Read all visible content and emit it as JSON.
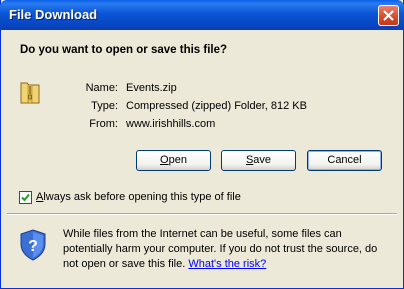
{
  "window": {
    "title": "File Download",
    "close_tooltip_icon": "close-icon"
  },
  "dialog": {
    "question": "Do you want to open or save this file?",
    "file_icon": "zip-folder-icon",
    "name_label": "Name:",
    "name_value": "Events.zip",
    "type_label": "Type:",
    "type_value": "Compressed (zipped) Folder, 812 KB",
    "from_label": "From:",
    "from_value": "www.irishhills.com"
  },
  "buttons": {
    "open": {
      "prefix": "",
      "accel": "O",
      "rest": "pen"
    },
    "save": {
      "prefix": "",
      "accel": "S",
      "rest": "ave"
    },
    "cancel": {
      "prefix": "",
      "accel": "",
      "rest": "Cancel"
    }
  },
  "checkbox": {
    "checked": true,
    "accel": "A",
    "rest": "lways ask before opening this type of file"
  },
  "warning": {
    "icon": "security-shield-icon",
    "text": "While files from the Internet can be useful, some files can potentially harm your computer. If you do not trust the source, do not open or save this file. ",
    "link": "What's the risk?"
  },
  "colors": {
    "titlebar": "#0a55d6",
    "dialog_bg": "#ece9d8",
    "link": "#0000ff"
  }
}
